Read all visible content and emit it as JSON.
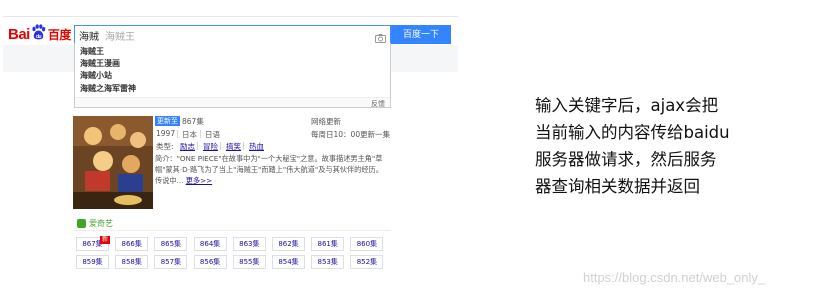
{
  "logo": {
    "latin": "Bai",
    "after_paw": "du",
    "cn": "百度"
  },
  "search": {
    "value": "海贼",
    "ghost": "海贼王",
    "button_label": "百度一下",
    "camera_icon": "camera-icon"
  },
  "suggestions": {
    "items": [
      "海贼王",
      "海贼王漫画",
      "海贼小站",
      "海贼之海军雷神"
    ],
    "feedback": "反馈"
  },
  "result": {
    "update_tag": "更新至",
    "update_ep": "867集",
    "network_update": "网络更新",
    "year": "1997",
    "region": "日本",
    "language": "日语",
    "schedule": "每周日10：00更新一集",
    "type_label": "类型:",
    "genres": [
      "励志",
      "冒险",
      "搞笑",
      "热血"
    ],
    "intro": "简介：\"ONE PIECE\"在故事中为\"一个大秘宝\"之意。故事描述男主角\"草帽\"蒙其·D·路飞为了当上\"海贼王\"而踏上\"伟大航道\"及与其伙伴的经历。传说中...",
    "more": "更多>>",
    "source_name": "爱奇艺",
    "new_badge": "新",
    "episodes_row1": [
      "867集",
      "866集",
      "865集",
      "864集",
      "863集",
      "862集",
      "861集",
      "860集"
    ],
    "episodes_row2": [
      "859集",
      "858集",
      "857集",
      "856集",
      "855集",
      "854集",
      "853集",
      "852集"
    ]
  },
  "note": {
    "lines": [
      "输入关键字后，ajax会把",
      "当前输入的内容传给baidu",
      "服务器做请求，然后服务",
      "器查询相关数据并返回"
    ]
  },
  "watermark": "https://blog.csdn.net/web_only_",
  "colors": {
    "brand_red": "#e10601",
    "brand_blue": "#3385ff",
    "link": "#1a0dab",
    "iqiyi_green": "#41a529"
  }
}
